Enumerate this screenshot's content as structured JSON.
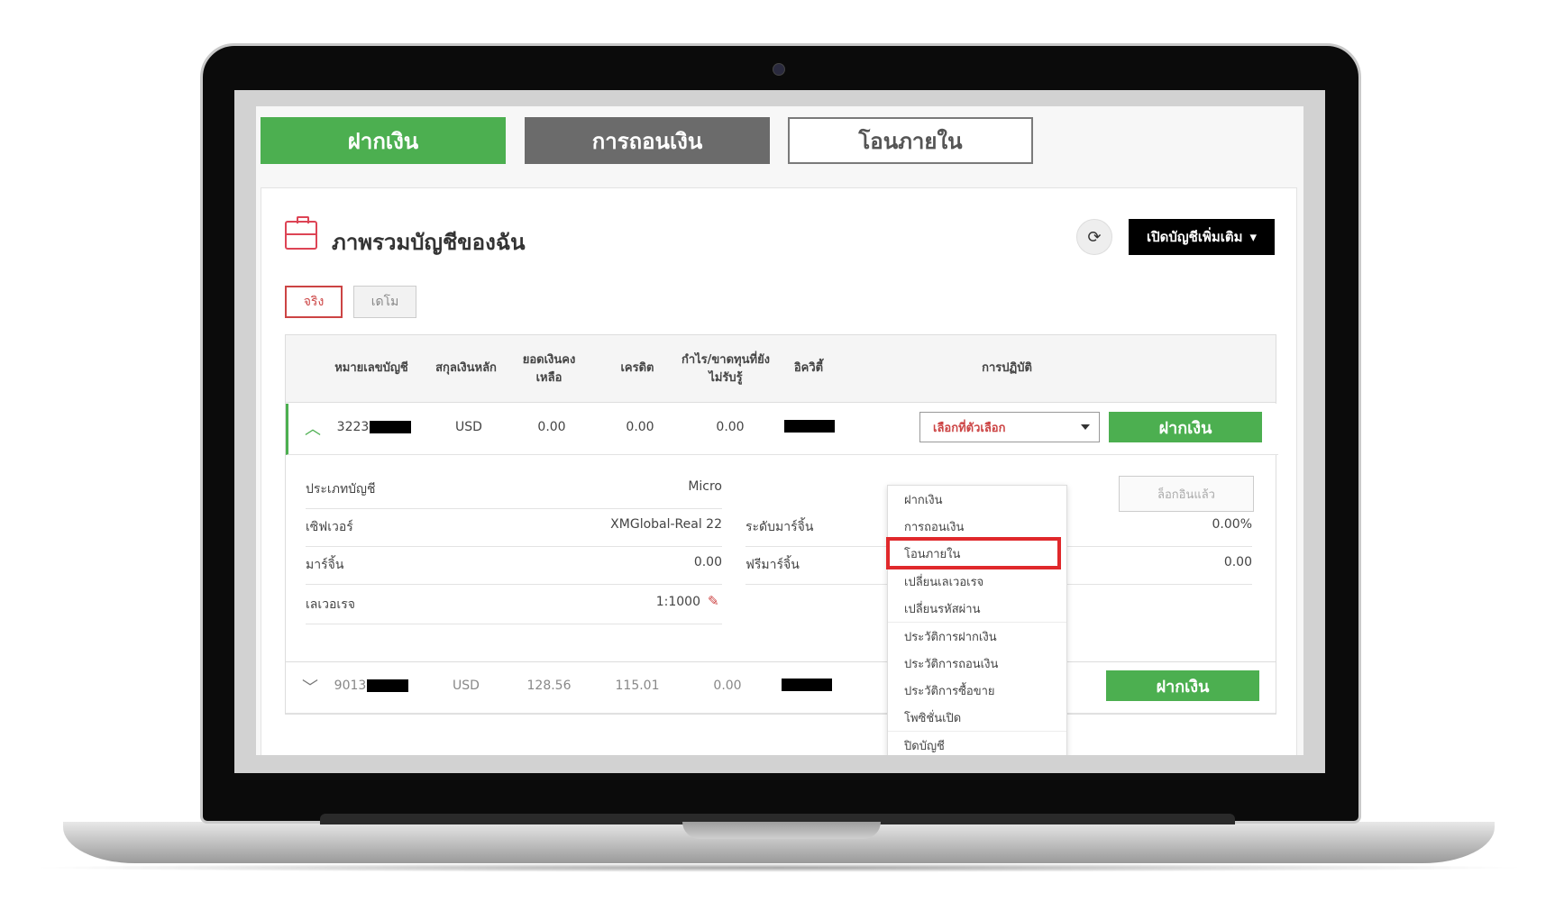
{
  "tabs": {
    "deposit": "ฝากเงิน",
    "withdraw": "การถอนเงิน",
    "transfer": "โอนภายใน"
  },
  "header": {
    "title": "ภาพรวมบัญชีของฉัน",
    "open_more": "เปิดบัญชีเพิ่มเติม",
    "refresh_icon": "refresh-icon"
  },
  "toggle": {
    "real": "จริง",
    "demo": "เดโม"
  },
  "table": {
    "columns": [
      "หมายเลขบัญชี",
      "สกุลเงินหลัก",
      "ยอดเงินคงเหลือ",
      "เครดิต",
      "กำไร/ขาดทุนที่ยังไม่รับรู้",
      "อิควิตี้",
      "การปฏิบัติ"
    ],
    "rows": [
      {
        "account": "3223",
        "currency": "USD",
        "balance": "0.00",
        "credit": "0.00",
        "pnl": "0.00",
        "action_select": "เลือกที่ตัวเลือก",
        "action_button": "ฝากเงิน"
      },
      {
        "account": "9013",
        "currency": "USD",
        "balance": "128.56",
        "credit": "115.01",
        "pnl": "0.00",
        "action_button": "ฝากเงิน"
      }
    ],
    "details": {
      "account_type_label": "ประเภทบัญชี",
      "account_type_value": "Micro",
      "server_label": "เซิฟเวอร์",
      "server_value": "XMGlobal-Real 22",
      "margin_label": "มาร์จิ้น",
      "margin_value": "0.00",
      "leverage_label": "เลเวอเรจ",
      "leverage_value": "1:1000",
      "margin_level_label": "ระดับมาร์จิ้น",
      "margin_level_value": "0.00%",
      "free_margin_label": "ฟรีมาร์จิ้น",
      "free_margin_value": "0.00",
      "locked_button": "ล็อกอินแล้ว"
    }
  },
  "dropdown": {
    "items": [
      "ฝากเงิน",
      "การถอนเงิน",
      "โอนภายใน",
      "เปลี่ยนเลเวอเรจ",
      "เปลี่ยนรหัสผ่าน",
      "ประวัติการฝากเงิน",
      "ประวัติการถอนเงิน",
      "ประวัติการซื้อขาย",
      "โพซิชั่นเปิด",
      "ปิดบัญชี"
    ],
    "highlighted": "โอนภายใน"
  },
  "colors": {
    "green": "#4caf50",
    "highlight": "#e0282b",
    "accent_red": "#cc4444"
  }
}
